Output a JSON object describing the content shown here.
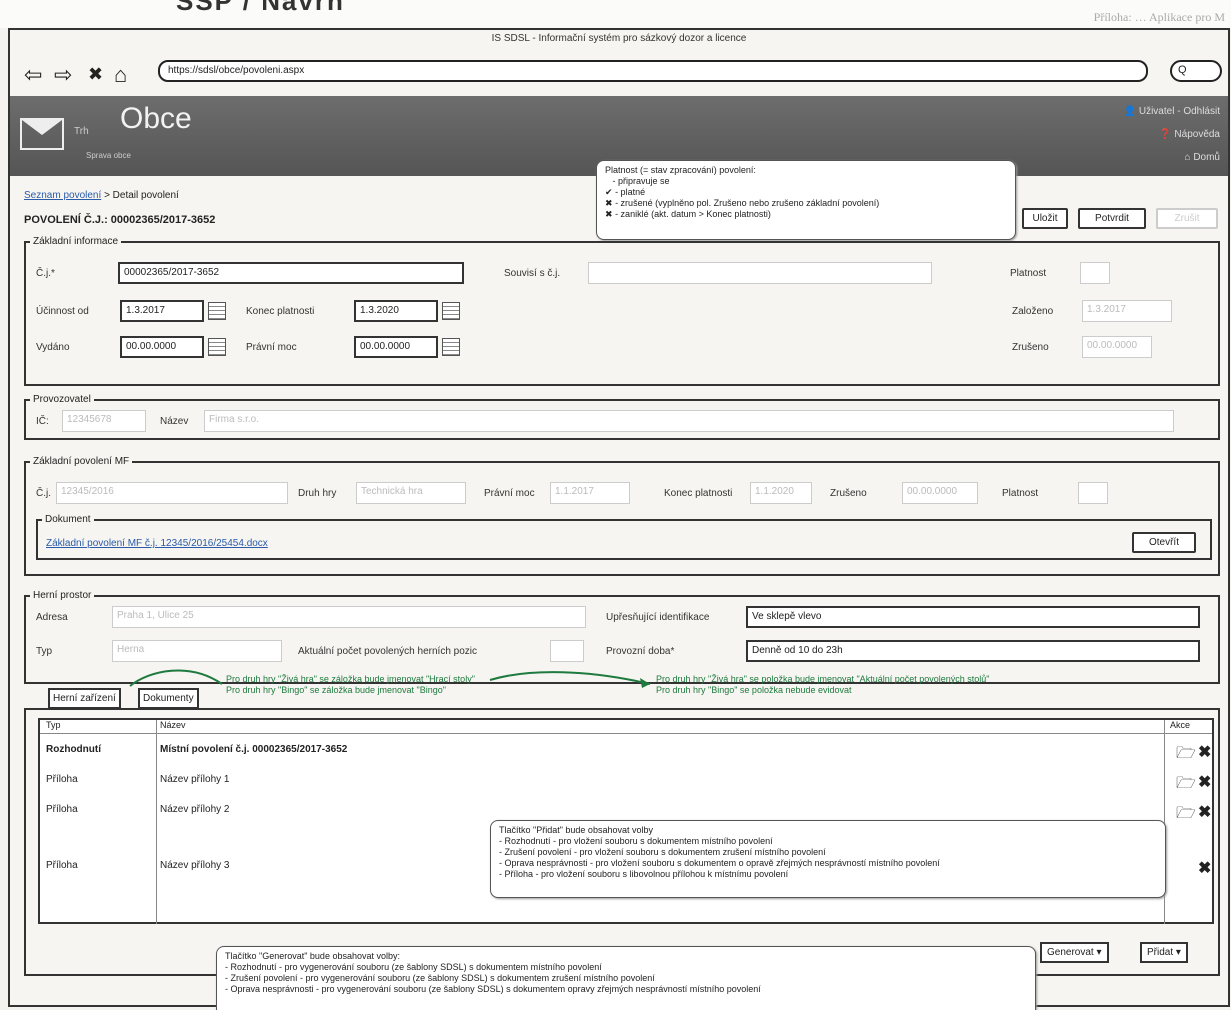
{
  "top": {
    "left_text": "SSP / Návrh",
    "right_text": "Příloha: … Aplikace pro M"
  },
  "browser": {
    "title": "IS SDSL - Informační systém pro sázkový dozor a licence",
    "url": "https://sdsl/obce/povoleni.aspx",
    "search": "Q"
  },
  "app": {
    "small": "Trh",
    "title": "Obce",
    "subtitle": "Sprava obce",
    "links": [
      "Uživatel - Odhlásit",
      "Nápověda",
      "Domů"
    ]
  },
  "breadcrumb": {
    "link": "Seznam povolení",
    "sep": "> Detail povolení"
  },
  "page_title": "POVOLENÍ Č.J.: 00002365/2017-3652",
  "buttons": {
    "save": "Uložit",
    "confirm": "Potvrdit",
    "cancel": "Zrušit",
    "open": "Otevřít",
    "generate": "Generovat ▾",
    "add": "Přidat ▾"
  },
  "callout_validity": {
    "title": "Platnost (= stav zpracování) povolení:",
    "items": [
      "- připravuje se",
      "- platné",
      "- zrušené (vyplněno pol. Zrušeno nebo zrušeno základní povolení)",
      "- zaniklé (akt. datum > Konec platnosti)"
    ]
  },
  "basic": {
    "legend": "Základní informace",
    "cj_label": "Č.j.*",
    "cj_value": "00002365/2017-3652",
    "rel_label": "Souvisí s č.j.",
    "rel_value": "",
    "from_label": "Účinnost od",
    "from_value": "1.3.2017",
    "end_label": "Konec platnosti",
    "end_value": "1.3.2020",
    "issued_label": "Vydáno",
    "issued_value": "00.00.0000",
    "legal_label": "Právní moc",
    "legal_value": "00.00.0000",
    "valid_label": "Platnost",
    "created_label": "Založeno",
    "created_value": "1.3.2017",
    "cancelled_label": "Zrušeno",
    "cancelled_value": "00.00.0000"
  },
  "operator": {
    "legend": "Provozovatel",
    "ico_label": "IČ:",
    "ico_value": "12345678",
    "name_label": "Název",
    "name_value": "Firma s.r.o."
  },
  "mf": {
    "legend": "Základní povolení MF",
    "cj_label": "Č.j.",
    "cj_value": "12345/2016",
    "game_label": "Druh hry",
    "game_value": "Technická hra",
    "legal_label": "Právní moc",
    "legal_value": "1.1.2017",
    "end_label": "Konec platnosti",
    "end_value": "1.1.2020",
    "cancel_label": "Zrušeno",
    "cancel_value": "00.00.0000",
    "valid_label": "Platnost",
    "doc_legend": "Dokument",
    "doc_link": "Základní povolení MF č.j. 12345/2016/25454.docx"
  },
  "venue": {
    "legend": "Herní prostor",
    "addr_label": "Adresa",
    "addr_value": "Praha 1, Ulice 25",
    "spec_label": "Upřesňující identifikace",
    "spec_value": "Ve sklepě vlevo",
    "type_label": "Typ",
    "type_value": "Herna",
    "count_label": "Aktuální počet povolených herních pozic",
    "hours_label": "Provozní doba*",
    "hours_value": "Denně od 10 do 23h"
  },
  "notes": {
    "tab_note_1": "Pro druh hry \"Živá hra\" se záložka bude jmenovat \"Hrací stoly\"",
    "tab_note_2": "Pro druh hry \"Bingo\" se záložka bude jmenovat \"Bingo\"",
    "field_note_1": "Pro druh hry \"Živá hra\" se položka bude jmenovat \"Aktuální počet povolených stolů\"",
    "field_note_2": "Pro druh hry \"Bingo\" se položka nebude evidovat"
  },
  "tabs": [
    "Herní zařízení",
    "Dokumenty"
  ],
  "table": {
    "headers": [
      "Typ",
      "Název",
      "Akce"
    ],
    "rows": [
      {
        "type": "Rozhodnutí",
        "name": "Místní povolení č.j. 00002365/2017-3652"
      },
      {
        "type": "Příloha",
        "name": "Název přílohy 1"
      },
      {
        "type": "Příloha",
        "name": "Název přílohy 2"
      },
      {
        "type": "Příloha",
        "name": "Název přílohy 3"
      }
    ]
  },
  "callout_add": {
    "title": "Tlačítko \"Přidat\" bude obsahovat volby",
    "items": [
      "- Rozhodnutí - pro vložení souboru s dokumentem místního povolení",
      "- Zrušení povolení - pro vložení souboru s dokumentem zrušení místního povolení",
      "- Oprava nesprávnosti - pro vložení souboru s dokumentem o opravě zřejmých nesprávností místního povolení",
      "- Příloha - pro vložení souboru s libovolnou přílohou k místnímu povolení"
    ]
  },
  "callout_gen": {
    "title": "Tlačítko \"Generovat\" bude obsahovat volby:",
    "items": [
      "- Rozhodnutí - pro vygenerování souboru (ze šablony SDSL) s dokumentem místního povolení",
      "- Zrušení povolení - pro vygenerování souboru (ze šablony SDSL) s dokumentem zrušení místního povolení",
      "- Oprava nesprávnosti - pro vygenerování souboru (ze šablony SDSL) s dokumentem opravy zřejmých nesprávností místního povolení"
    ]
  }
}
